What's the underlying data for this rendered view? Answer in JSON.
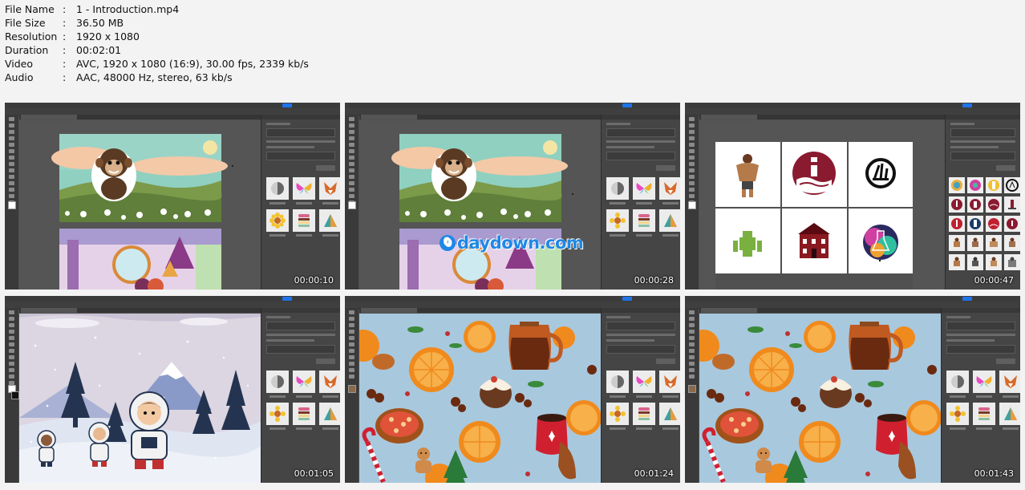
{
  "metadata": [
    {
      "key": "File Name",
      "value": "1 - Introduction.mp4"
    },
    {
      "key": "File Size",
      "value": "36.50 MB"
    },
    {
      "key": "Resolution",
      "value": "1920 x 1080"
    },
    {
      "key": "Duration",
      "value": "00:02:01"
    },
    {
      "key": "Video",
      "value": "AVC, 1920 x 1080 (16:9), 30.00 fps, 2339 kb/s"
    },
    {
      "key": "Audio",
      "value": "AAC, 48000 Hz, stereo, 63 kb/s"
    }
  ],
  "separator": ":",
  "thumbnails": [
    {
      "timestamp": "00:00:10",
      "scene": "chimp-landscape"
    },
    {
      "timestamp": "00:00:28",
      "scene": "chimp-landscape"
    },
    {
      "timestamp": "00:00:47",
      "scene": "logo-grid"
    },
    {
      "timestamp": "00:01:05",
      "scene": "astronauts"
    },
    {
      "timestamp": "00:01:24",
      "scene": "food-pattern"
    },
    {
      "timestamp": "00:01:43",
      "scene": "food-pattern"
    }
  ],
  "watermark": {
    "symbol": "0",
    "text": "daydown.com"
  },
  "colors": {
    "ps_background": "#505050",
    "canvas_sky": "#8fd0c0",
    "pattern_bg": "#a8c8de",
    "orange": "#f08a1c",
    "accent_blue": "#1f73e8"
  }
}
